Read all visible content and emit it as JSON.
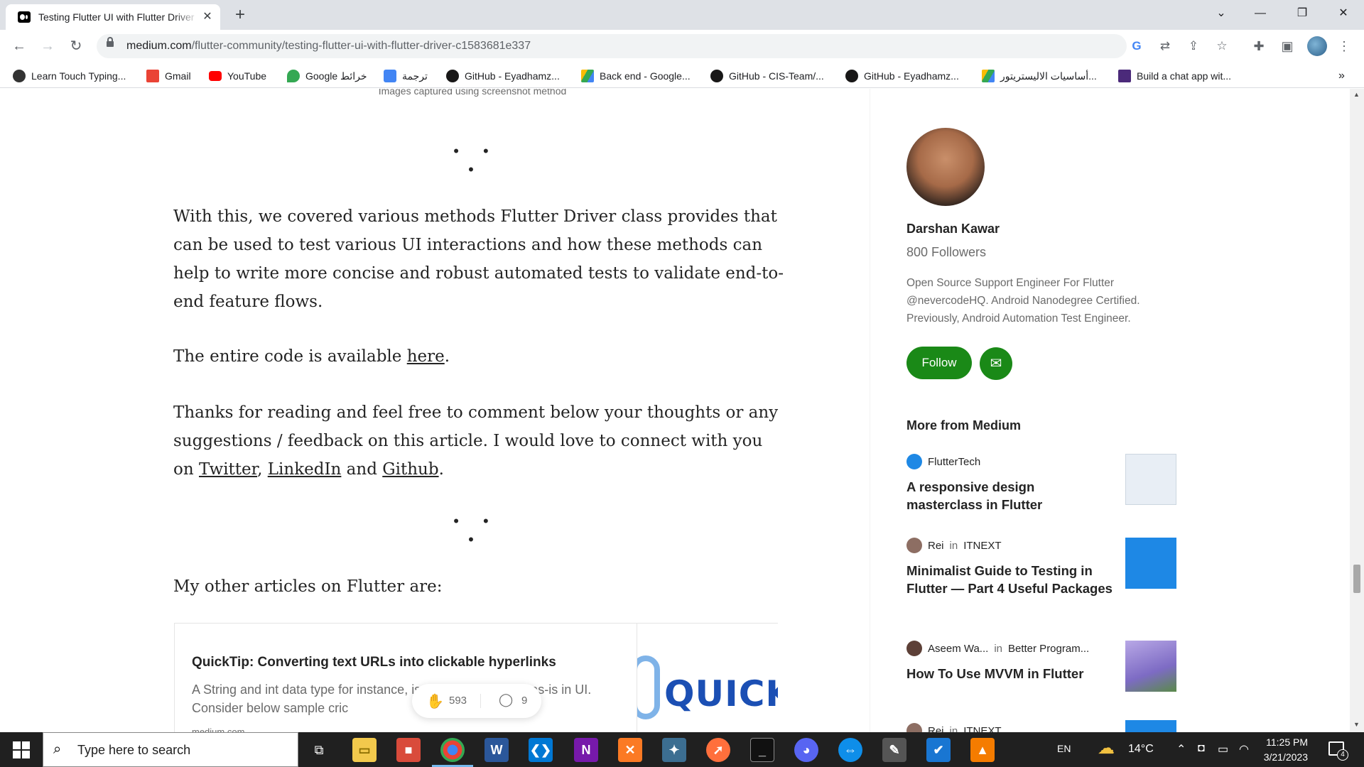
{
  "browser": {
    "tab_title": "Testing Flutter UI with Flutter Driver",
    "tab_close": "✕",
    "new_tab": "+",
    "window_controls": {
      "tab_search": "⌄",
      "minimize": "—",
      "restore": "❐",
      "close": "✕"
    },
    "url_host": "medium.com",
    "url_path": "/flutter-community/testing-flutter-ui-with-flutter-driver-c1583681e337",
    "bookmarks": [
      {
        "label": "Learn Touch Typing...",
        "icon": "typing-icon",
        "color": "#333333"
      },
      {
        "label": "Gmail",
        "icon": "gmail-icon",
        "color": "#ea4335"
      },
      {
        "label": "YouTube",
        "icon": "youtube-icon",
        "color": "#ff0000"
      },
      {
        "label": "Google خرائط",
        "icon": "maps-icon",
        "color": "#34a853"
      },
      {
        "label": "ترجمة",
        "icon": "translate-icon",
        "color": "#4285f4"
      },
      {
        "label": "GitHub - Eyadhamz...",
        "icon": "github-icon",
        "color": "#181717"
      },
      {
        "label": "Back end - Google...",
        "icon": "drive-icon",
        "color": "#fbbc04"
      },
      {
        "label": "GitHub - CIS-Team/...",
        "icon": "github-icon",
        "color": "#181717"
      },
      {
        "label": "GitHub - Eyadhamz...",
        "icon": "github-icon",
        "color": "#181717"
      },
      {
        "label": "أساسيات الاليستريتور...",
        "icon": "drive-icon",
        "color": "#fbbc04"
      },
      {
        "label": "Build a chat app wit...",
        "icon": "chat-app-icon",
        "color": "#4b2a7a"
      }
    ],
    "bookmarks_overflow": "»"
  },
  "article": {
    "caption": "Images captured using screenshot method",
    "separator": "• • •",
    "p1": "With this, we covered various methods Flutter Driver class provides that can be used to test various UI interactions and how these methods can help to write more concise and robust automated tests to validate end-to-end feature flows.",
    "p2_prefix": "The entire code is available ",
    "p2_link": "here",
    "p2_suffix": ".",
    "p3_prefix": "Thanks for reading and feel free to comment below your thoughts or any suggestions / feedback on this article. I would love to connect with you on ",
    "p3_link_twitter": "Twitter",
    "p3_comma": ", ",
    "p3_link_linkedin": "LinkedIn",
    "p3_and": " and ",
    "p3_link_github": "Github",
    "p3_end": ".",
    "other_articles": "My other articles on Flutter are:",
    "card": {
      "title": "QuickTip: Converting text URLs into clickable hyperlinks",
      "description": "A String and int data type for instance, is typically displayed as-is in UI. Consider below sample cric",
      "domain": "medium.com",
      "image_text": "QUICKT"
    },
    "claps": "593",
    "responses": "9"
  },
  "sidebar": {
    "author_name": "Darshan Kawar",
    "followers": "800 Followers",
    "bio": "Open Source Support Engineer For Flutter @nevercodeHQ. Android Nanodegree Certified. Previously, Android Automation Test Engineer.",
    "follow_label": "Follow",
    "subscribe_icon": "✉",
    "more_from_heading": "More from Medium",
    "more_from": [
      {
        "author": "",
        "in": "",
        "publication": "FlutterTech",
        "title": "A responsive design masterclass in Flutter",
        "icon_color": "#1e88e5",
        "thumb_color": "#e8eef5"
      },
      {
        "author": "Rei",
        "in": "in",
        "publication": "ITNEXT",
        "title": "Minimalist Guide to Testing in Flutter — Part 4 Useful Packages",
        "icon_color": "#8d6e63",
        "thumb_color": "#1e88e5"
      },
      {
        "author": "Aseem Wa...",
        "in": "in",
        "publication": "Better Program...",
        "title": "How To Use MVVM in Flutter",
        "icon_color": "#5d4037",
        "thumb_color": "#9c8ad6"
      },
      {
        "author": "Rei",
        "in": "in",
        "publication": "ITNEXT",
        "title": "",
        "icon_color": "#8d6e63",
        "thumb_color": "#1e88e5"
      }
    ]
  },
  "taskbar": {
    "search_placeholder": "Type here to search",
    "language": "EN",
    "temperature": "14°C",
    "time": "11:25 PM",
    "date": "3/21/2023",
    "notification_count": "4"
  },
  "colors": {
    "medium_green": "#1a8917",
    "taskbar_bg": "#202020",
    "text_primary": "#242424",
    "text_secondary": "#6b6b6b"
  }
}
